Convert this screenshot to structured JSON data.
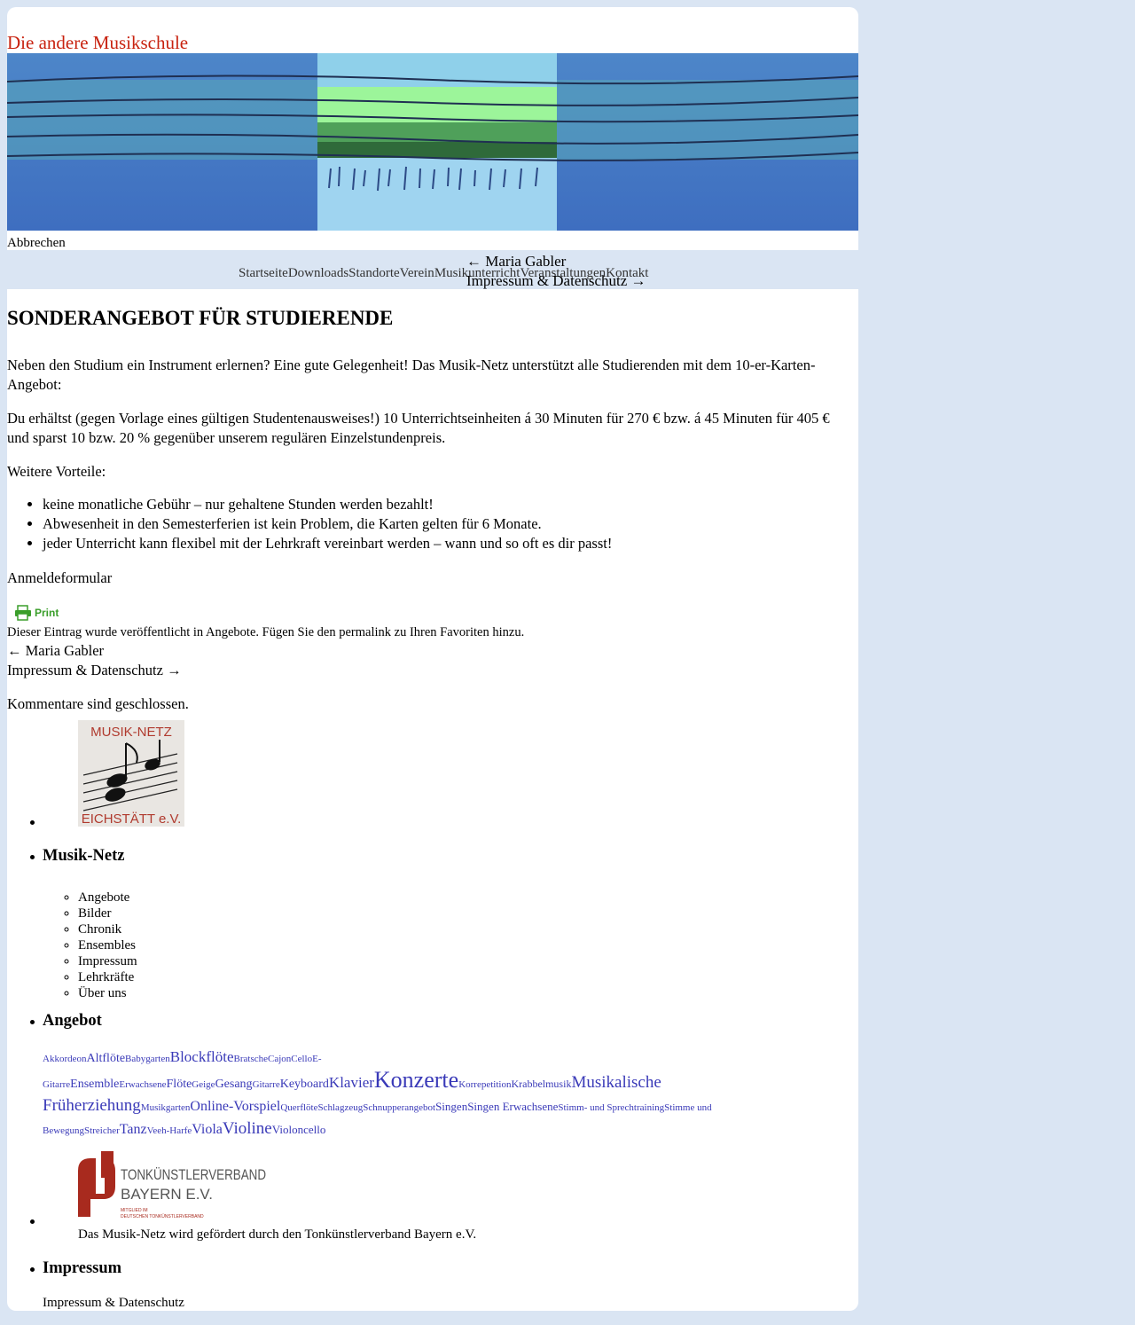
{
  "site": {
    "title": "Die andere Musikschule",
    "cancel": "Abbrechen"
  },
  "menu": [
    "Startseite",
    "Downloads",
    "Standorte",
    "Verein",
    "Musikunterricht",
    "Veranstaltungen",
    "Kontakt"
  ],
  "top_nav": {
    "prev": "← Maria Gabler",
    "next": "Impressum & Datenschutz →"
  },
  "post": {
    "title": "SONDERANGEBOT FÜR STUDIERENDE",
    "p1": "Neben den Studium ein Instrument erlernen? Eine gute Gelegenheit! Das Musik-Netz unterstützt alle Studierenden mit dem 10-er-Karten-Angebot:",
    "p2": "Du erhältst (gegen Vorlage eines gültigen Studentenausweises!) 10 Unterrichtseinheiten á 30 Minuten für 270 € bzw. á 45 Minuten für 405 € und sparst 10 bzw. 20 % gegenüber unserem regulären Einzelstundenpreis.",
    "p3": "Weitere Vorteile:",
    "bullets": [
      "keine monatliche Gebühr – nur gehaltene Stunden werden bezahlt!",
      "Abwesenheit in den Semesterferien ist kein Problem, die Karten gelten für 6 Monate.",
      "jeder Unterricht kann flexibel mit der Lehrkraft vereinbart werden – wann und so oft es dir passt!"
    ],
    "form_link": "Anmeldeformular",
    "print": "Print",
    "meta": "Dieser Eintrag wurde veröffentlicht in Angebote. Fügen Sie den permalink zu Ihren Favoriten hinzu.",
    "prev": "← Maria Gabler",
    "next": "Impressum & Datenschutz →",
    "comments": "Kommentare sind geschlossen."
  },
  "sidebar": {
    "logo_top": "MUSIK-NETZ",
    "logo_bottom": "EICHSTÄTT e.V.",
    "musik_netz_heading": "Musik-Netz",
    "musik_netz_items": [
      "Angebote",
      "Bilder",
      "Chronik",
      "Ensembles",
      "Impressum",
      "Lehrkräfte",
      "Über uns"
    ],
    "angebot_heading": "Angebot",
    "tags": [
      {
        "t": "Akkordeon",
        "s": 11
      },
      {
        "t": "Altflöte",
        "s": 14
      },
      {
        "t": "Babygarten",
        "s": 11
      },
      {
        "t": "Blockflöte",
        "s": 17
      },
      {
        "t": "Bratsche",
        "s": 11
      },
      {
        "t": "Cajon",
        "s": 11
      },
      {
        "t": "Cello",
        "s": 11
      },
      {
        "t": "E-Gitarre",
        "s": 11
      },
      {
        "t": "Ensemble",
        "s": 14
      },
      {
        "t": "Erwachsene",
        "s": 11
      },
      {
        "t": "Flöte",
        "s": 14
      },
      {
        "t": "Geige",
        "s": 11
      },
      {
        "t": "Gesang",
        "s": 14
      },
      {
        "t": "Gitarre",
        "s": 11
      },
      {
        "t": "Keyboard",
        "s": 14
      },
      {
        "t": "Klavier",
        "s": 17
      },
      {
        "t": "Konzerte",
        "s": 26
      },
      {
        "t": "Korrepetition",
        "s": 11
      },
      {
        "t": "Krabbelmusik",
        "s": 12
      },
      {
        "t": "Musikalische Früherziehung",
        "s": 19
      },
      {
        "t": "Musikgarten",
        "s": 11
      },
      {
        "t": "Online-Vorspiel",
        "s": 16
      },
      {
        "t": "Querflöte",
        "s": 11
      },
      {
        "t": "Schlagzeug",
        "s": 11
      },
      {
        "t": "Schnupperangebot",
        "s": 11
      },
      {
        "t": "Singen",
        "s": 13
      },
      {
        "t": "Singen Erwachsene",
        "s": 13
      },
      {
        "t": "Stimm- und Sprechtraining",
        "s": 11
      },
      {
        "t": "Stimme und Bewegung",
        "s": 11
      },
      {
        "t": "Streicher",
        "s": 11
      },
      {
        "t": "Tanz",
        "s": 16
      },
      {
        "t": "Veeh-Harfe",
        "s": 11
      },
      {
        "t": "Viola",
        "s": 16
      },
      {
        "t": "Violine",
        "s": 19
      },
      {
        "t": "Violoncello",
        "s": 13
      }
    ],
    "tk_logo_line1": "TONKÜNSTLERVERBAND",
    "tk_logo_line2": "BAYERN E.V.",
    "tk_logo_small1": "MITGLIED IM",
    "tk_logo_small2": "DEUTSCHEN TONKÜNSTLERVERBAND",
    "tk_caption": "Das Musik-Netz wird gefördert durch den Tonkünstlerverband Bayern e.V.",
    "impressum_heading": "Impressum",
    "impressum_link": "Impressum & Datenschutz"
  },
  "colors": {
    "page_bg": "#dae5f3",
    "title_red": "#c8220f",
    "tag_blue": "#3a3ab8",
    "print_green": "#3a9e2a"
  }
}
